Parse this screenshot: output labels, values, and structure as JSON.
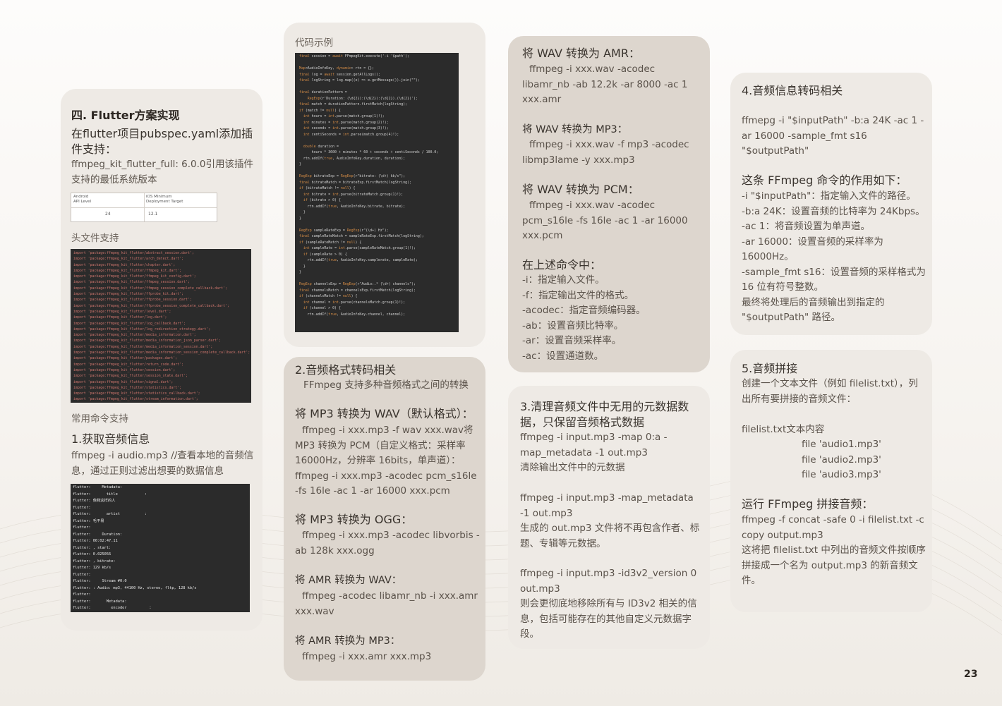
{
  "page_number": "23",
  "col1": {
    "title": "四. Flutter方案实现",
    "subtitle": "在flutter项目pubspec.yaml添加插件支持：",
    "dep_text": "ffmpeg_kit_flutter_full: 6.0.0引用该插件支持的最低系统版本",
    "table": {
      "h1": "Android\nAPI Level",
      "h2": "iOS Minimum\nDeployment Target",
      "v1": "24",
      "v2": "12.1"
    },
    "headers_label": "头文件支持",
    "imports": [
      "import 'package:ffmpeg_kit_flutter/abstract_session.dart';",
      "import 'package:ffmpeg_kit_flutter/arch_detect.dart';",
      "import 'package:ffmpeg_kit_flutter/chapter.dart';",
      "import 'package:ffmpeg_kit_flutter/ffmpeg_kit.dart';",
      "import 'package:ffmpeg_kit_flutter/ffmpeg_kit_config.dart';",
      "import 'package:ffmpeg_kit_flutter/ffmpeg_session.dart';",
      "import 'package:ffmpeg_kit_flutter/ffmpeg_session_complete_callback.dart';",
      "import 'package:ffmpeg_kit_flutter/ffprobe_kit.dart';",
      "import 'package:ffmpeg_kit_flutter/ffprobe_session.dart';",
      "import 'package:ffmpeg_kit_flutter/ffprobe_session_complete_callback.dart';",
      "import 'package:ffmpeg_kit_flutter/level.dart';",
      "import 'package:ffmpeg_kit_flutter/log.dart';",
      "import 'package:ffmpeg_kit_flutter/log_callback.dart';",
      "import 'package:ffmpeg_kit_flutter/log_redirection_strategy.dart';",
      "import 'package:ffmpeg_kit_flutter/media_information.dart';",
      "import 'package:ffmpeg_kit_flutter/media_information_json_parser.dart';",
      "import 'package:ffmpeg_kit_flutter/media_information_session.dart';",
      "import 'package:ffmpeg_kit_flutter/media_information_session_complete_callback.dart';",
      "import 'package:ffmpeg_kit_flutter/packages.dart';",
      "import 'package:ffmpeg_kit_flutter/return_code.dart';",
      "import 'package:ffmpeg_kit_flutter/session.dart';",
      "import 'package:ffmpeg_kit_flutter/session_state.dart';",
      "import 'package:ffmpeg_kit_flutter/signal.dart';",
      "import 'package:ffmpeg_kit_flutter/statistics.dart';",
      "import 'package:ffmpeg_kit_flutter/statistics_callback.dart';",
      "import 'package:ffmpeg_kit_flutter/stream_information.dart';"
    ],
    "commands_label": "常用命令支持",
    "get_info_title": "1.获取音频信息",
    "get_info_text": "ffmpeg -i audio.mp3    //查看本地的音频信息，通过正则过滤出想要的数据信息",
    "console": [
      "flutter:     Metadata:",
      "flutter:       title            :",
      "flutter: 像我这样的人",
      "flutter:",
      "flutter:       artist           :",
      "flutter: 毛不易",
      "flutter:",
      "flutter:     Duration:",
      "flutter: 00:02:47.11",
      "flutter: , start:",
      "flutter: 0.025056",
      "flutter: , bitrate:",
      "flutter: 129 kb/s",
      "flutter:",
      "flutter:     Stream #0:0",
      "flutter: : Audio: mp3, 44100 Hz, stereo, fltp, 128 kb/s",
      "flutter:",
      "flutter:       Metadata:",
      "flutter:         encoder          :"
    ]
  },
  "col2": {
    "code_label": "代码示例",
    "code": [
      "final session = await FFmpegKit.execute('-i '$path');",
      "",
      "Map<AudioInfoKey, dynamic> rtn = {};",
      "final log = await session.getAllLogs();",
      "final logString = log.map((e) => e.getMessage()).join(\"\");",
      "",
      "final durationPattern =",
      "    RegExp(r'Duration: (\\d{2}):(\\d{2}):(\\d{2}).(\\d{2})');",
      "final match = durationPattern.firstMatch(logString);",
      "if (match != null) {",
      "  int hours = int.parse(match.group(1)!);",
      "  int minutes = int.parse(match.group(2)!);",
      "  int seconds = int.parse(match.group(3)!);",
      "  int centiSeconds = int.parse(match.group(4)!);",
      "",
      "  double duration =",
      "      hours * 3600 + minutes * 60 + seconds + centiSeconds / 100.0;",
      "  rtn.addIf(true, AudioInfoKey.duration, duration);",
      "}",
      "",
      "RegExp bitrateExp = RegExp(r\"bitrate: (\\d+) kb/s\");",
      "final bitrateMatch = bitrateExp.firstMatch(logString);",
      "if (bitrateMatch != null) {",
      "  int bitrate = int.parse(bitrateMatch.group(1)!);",
      "  if (bitrate > 0) {",
      "    rtn.addIf(true, AudioInfoKey.bitrate, bitrate);",
      "  }",
      "}",
      "",
      "RegExp sampleRateExp = RegExp(r\"(\\d+) Hz\");",
      "final sampleRateMatch = sampleRateExp.firstMatch(logString);",
      "if (sampleRateMatch != null) {",
      "  int sampleRate = int.parse(sampleRateMatch.group(1)!);",
      "  if (sampleRate > 0) {",
      "    rtn.addIf(true, AudioInfoKey.samplerate, sampleRate);",
      "  }",
      "}",
      "",
      "RegExp channelsExp = RegExp(r\"Audio:.* (\\d+) channels\");",
      "final channelsMatch = channelsExp.firstMatch(logString);",
      "if (channelsMatch != null) {",
      "  int channel = int.parse(channelsMatch.group(1)!);",
      "  if (channel > 0) {",
      "    rtn.addIf(true, AudioInfoKey.channel, channel);"
    ],
    "fmt_title": "2.音频格式转码相关",
    "fmt_intro": "FFmpeg 支持多种音频格式之间的转换",
    "mp3_wav_title": "将 MP3 转换为 WAV（默认格式）：",
    "mp3_wav_text": "ffmpeg -i xxx.mp3 -f wav xxx.wav将MP3 转换为 PCM（自定义格式：采样率 16000Hz，分辨率 16bits，单声道）：ffmpeg -i xxx.mp3 -acodec pcm_s16le -fs 16le -ac 1 -ar 16000 xxx.pcm",
    "mp3_ogg_title": "将 MP3 转换为 OGG：",
    "mp3_ogg_text": "ffmpeg -i xxx.mp3 -acodec libvorbis -ab 128k xxx.ogg",
    "amr_wav_title": "将 AMR 转换为 WAV：",
    "amr_wav_text": "ffmpeg -acodec libamr_nb -i xxx.amr xxx.wav",
    "amr_mp3_title": "将 AMR 转换为 MP3：",
    "amr_mp3_text": "ffmpeg -i xxx.amr xxx.mp3"
  },
  "col3": {
    "wav_amr_title": "将 WAV 转换为 AMR：",
    "wav_amr_text": "ffmpeg -i xxx.wav -acodec libamr_nb -ab 12.2k -ar 8000 -ac 1 xxx.amr",
    "wav_mp3_title": "将 WAV 转换为 MP3：",
    "wav_mp3_text": "ffmpeg -i xxx.wav -f mp3 -acodec libmp3lame -y xxx.mp3",
    "wav_pcm_title": "将 WAV 转换为 PCM：",
    "wav_pcm_text": "ffmpeg -i xxx.wav -acodec pcm_s16le -fs 16le -ac 1 -ar 16000 xxx.pcm",
    "in_above_title": "在上述命令中：",
    "in_above_items": [
      "-i：指定输入文件。",
      "-f：指定输出文件的格式。",
      "-acodec：指定音频编码器。",
      "-ab：设置音频比特率。",
      "-ar：设置音频采样率。",
      "-ac：设置通道数。"
    ],
    "clean_title": "3.清理音频文件中无用的元数据数据，只保留音频格式数据",
    "clean_cmd1": "ffmpeg -i input.mp3 -map 0:a -map_metadata -1 out.mp3",
    "clean_desc1": "清除输出文件中的元数据",
    "clean_cmd2": "ffmpeg -i input.mp3 -map_metadata -1 out.mp3",
    "clean_desc2": "生成的 out.mp3 文件将不再包含作者、标题、专辑等元数据。",
    "clean_cmd3": "ffmpeg -i input.mp3 -id3v2_version 0 out.mp3",
    "clean_desc3": "则会更彻底地移除所有与 ID3v2 相关的信息，包括可能存在的其他自定义元数据字段。"
  },
  "col4": {
    "info_title": "4.音频信息转码相关",
    "info_cmd": "ffmepg -i \"$inputPath\" -b:a 24K -ac 1 -ar 16000 -sample_fmt s16 \"$outputPath\"",
    "effect_title": "这条 FFmpeg 命令的作用如下：",
    "effect_items": [
      "-i \"$inputPath\"：指定输入文件的路径。",
      "-b:a 24K：设置音频的比特率为 24Kbps。",
      "-ac 1：将音频设置为单声道。",
      "-ar 16000：设置音频的采样率为 16000Hz。",
      "-sample_fmt s16：设置音频的采样格式为 16 位有符号整数。",
      "最终将处理后的音频输出到指定的 \"$outputPath\" 路径。"
    ],
    "concat_title": "5.音频拼接",
    "concat_intro": "创建一个文本文件（例如 filelist.txt），列出所有要拼接的音频文件：",
    "filelist_label": "filelist.txt文本内容",
    "filelist": [
      "file 'audio1.mp3'",
      "file 'audio2.mp3'",
      "file 'audio3.mp3'"
    ],
    "run_title": "运行 FFmpeg 拼接音频：",
    "run_cmd": "ffmpeg -f concat -safe 0 -i filelist.txt -c copy output.mp3",
    "run_desc": "这将把 filelist.txt 中列出的音频文件按顺序拼接成一个名为 output.mp3 的新音频文件。"
  },
  "colors": {
    "code_bg": "#2b2b2b",
    "import_text": "#c9736b",
    "console_text": "#e8e8e8"
  }
}
